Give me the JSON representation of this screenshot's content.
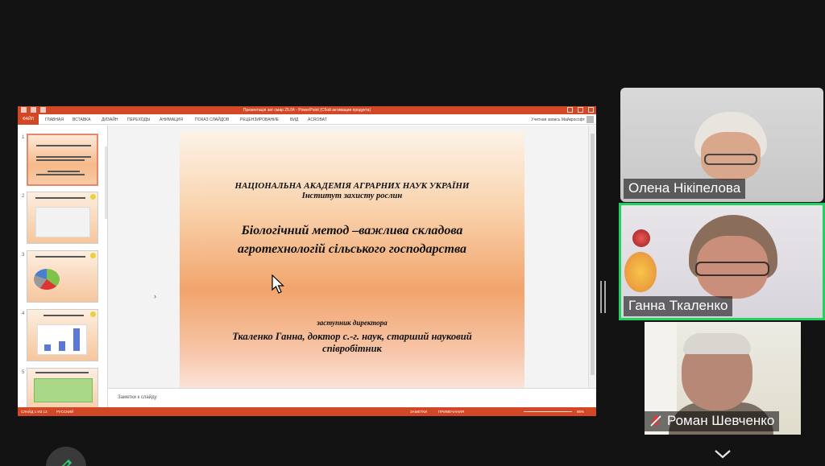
{
  "powerpoint": {
    "window_title": "Презентація зат смар 25.04 - PowerPoint (Сбой активации продукта)",
    "file_tab": "ФАЙЛ",
    "tabs": [
      "ГЛАВНАЯ",
      "ВСТАВКА",
      "ДИЗАЙН",
      "ПЕРЕХОДЫ",
      "АНИМАЦИЯ",
      "ПОКАЗ СЛАЙДОВ",
      "РЕЦЕНЗИРОВАНИЕ",
      "ВИД",
      "ACROBAT"
    ],
    "account": "Учетная запись Майкрософт",
    "thumbnail_numbers": [
      "1",
      "2",
      "3",
      "4",
      "5"
    ],
    "slide": {
      "org": "НАЦІОНАЛЬНА АКАДЕМІЯ АГРАРНИХ НАУК УКРАЇНИ",
      "institute": "Інститут захисту рослин",
      "title_line1": "Біологічний метод –важлива складова",
      "title_line2": "агротехнологій сільського господарства",
      "role": "заступник директора",
      "author_line1": "Ткаленко Ганна, доктор с.-г. наук, старший науковий",
      "author_line2": "співробітник"
    },
    "notes_placeholder": "Заметки к слайду",
    "status": {
      "slide_counter": "СЛАЙД 1 ИЗ 13",
      "language": "РУССКИЙ",
      "notes_button": "ЗАМЕТКИ",
      "comments_button": "ПРИМЕЧАНИЯ",
      "zoom": "85%"
    }
  },
  "participants": [
    {
      "name": "Олена Нікіпелова",
      "active": false,
      "muted": false
    },
    {
      "name": "Ганна Ткаленко",
      "active": true,
      "muted": false
    },
    {
      "name": "Роман Шевченко",
      "active": false,
      "muted": true
    }
  ],
  "colors": {
    "powerpoint_accent": "#d24726",
    "active_speaker_border": "#23d160",
    "background": "#131313"
  },
  "icons": [
    "pencil-icon",
    "chevron-down-icon",
    "mic-off-icon",
    "mouse-pointer-icon"
  ]
}
